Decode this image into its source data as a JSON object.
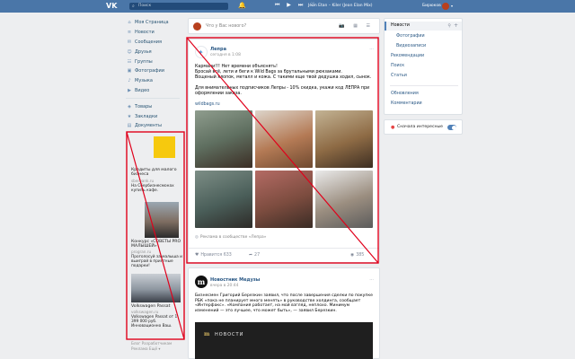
{
  "topbar": {
    "logo": "VK",
    "search_placeholder": "Поиск",
    "bell_icon": "bell-icon",
    "player_icons": "⏮ ▶ ⏭ ♡",
    "now_playing": "Jeon Etan – Kiler (Jean Elan Mix)",
    "user_name": "Бирюков"
  },
  "nav": [
    {
      "icon": "⌂",
      "label": "Моя Страница"
    },
    {
      "icon": "≡",
      "label": "Новости"
    },
    {
      "icon": "✉",
      "label": "Сообщения"
    },
    {
      "icon": "☺",
      "label": "Друзья"
    },
    {
      "icon": "☷",
      "label": "Группы"
    },
    {
      "icon": "▣",
      "label": "Фотографии"
    },
    {
      "icon": "♪",
      "label": "Музыка"
    },
    {
      "icon": "▶",
      "label": "Видео"
    }
  ],
  "nav2": [
    {
      "icon": "◈",
      "label": "Товары"
    },
    {
      "icon": "★",
      "label": "Закладки"
    },
    {
      "icon": "▤",
      "label": "Документы"
    }
  ],
  "ads": {
    "a1_title": "Кредиты для малого бизнеса",
    "a1_link": "sberbank.ru",
    "a1_text": "На Сбербизнесмонах купить кафе.",
    "a2_title": "Конкурс «СОВЕТЫ PRO МАЛЫШЕЙ»",
    "a2_link": "progran.ru",
    "a2_text": "Проголосуй за малыша и выиграй в приятные подарки!",
    "a3_title": "Volkswagen Passat",
    "a3_link": "volkswagen.ru",
    "a3_text": "Volkswagen Passat от 1 399 000 руб. Инновационно Ваш."
  },
  "footer_links": [
    "Блог  Разработчикам",
    "Реклама  Ещё ▾"
  ],
  "composer": {
    "placeholder": "Что у Вас нового?",
    "icons": "📷 ▦ ☰"
  },
  "post1": {
    "author": "Лепра",
    "time": "сегодня в 1:08",
    "line1": "Кармани!!! Нет времени объяснять!",
    "line2": "Бросай всё, лети и беги к Wild Bags за брутальными рюкзаками.",
    "line3": "Вощеный хлопок, металл и кожа. С такими еще твой дедушка ходил, сынок.",
    "line4": "Для внимательных подписчиков Лепры - 10% скидка, укажи код ЛЕПРА при оформлении заказа.",
    "link": "wildbags.ru",
    "ad_mark": "Реклама в сообществе «Лепра»",
    "likes_label": "Нравится",
    "likes": "633",
    "shares": "27",
    "views": "385"
  },
  "post2": {
    "author": "Новостник Медузы",
    "time": "вчера в 20:44",
    "text": "Бизнесмен Григорий Березкин заявил, что после завершения сделки по покупке РБК «пока не планирует много менять» в руководстве холдинга, сообщает «Интерфакс». «Компания работает, на мой взгляд, неплохо. Минимум изменений — это лучшее, что может быть», — заявил Березкин.",
    "banner_label": "НОВОСТИ"
  },
  "right_panel": {
    "items": [
      "Новости",
      "Фотографии",
      "Видеозаписи",
      "Рекомендации",
      "Поиск",
      "Статьи"
    ],
    "items2": [
      "Обновления",
      "Комментарии"
    ],
    "smart_feed": "Сначала интересные"
  },
  "colors": {
    "brand": "#4a76a8",
    "annotation": "#e0001b"
  }
}
